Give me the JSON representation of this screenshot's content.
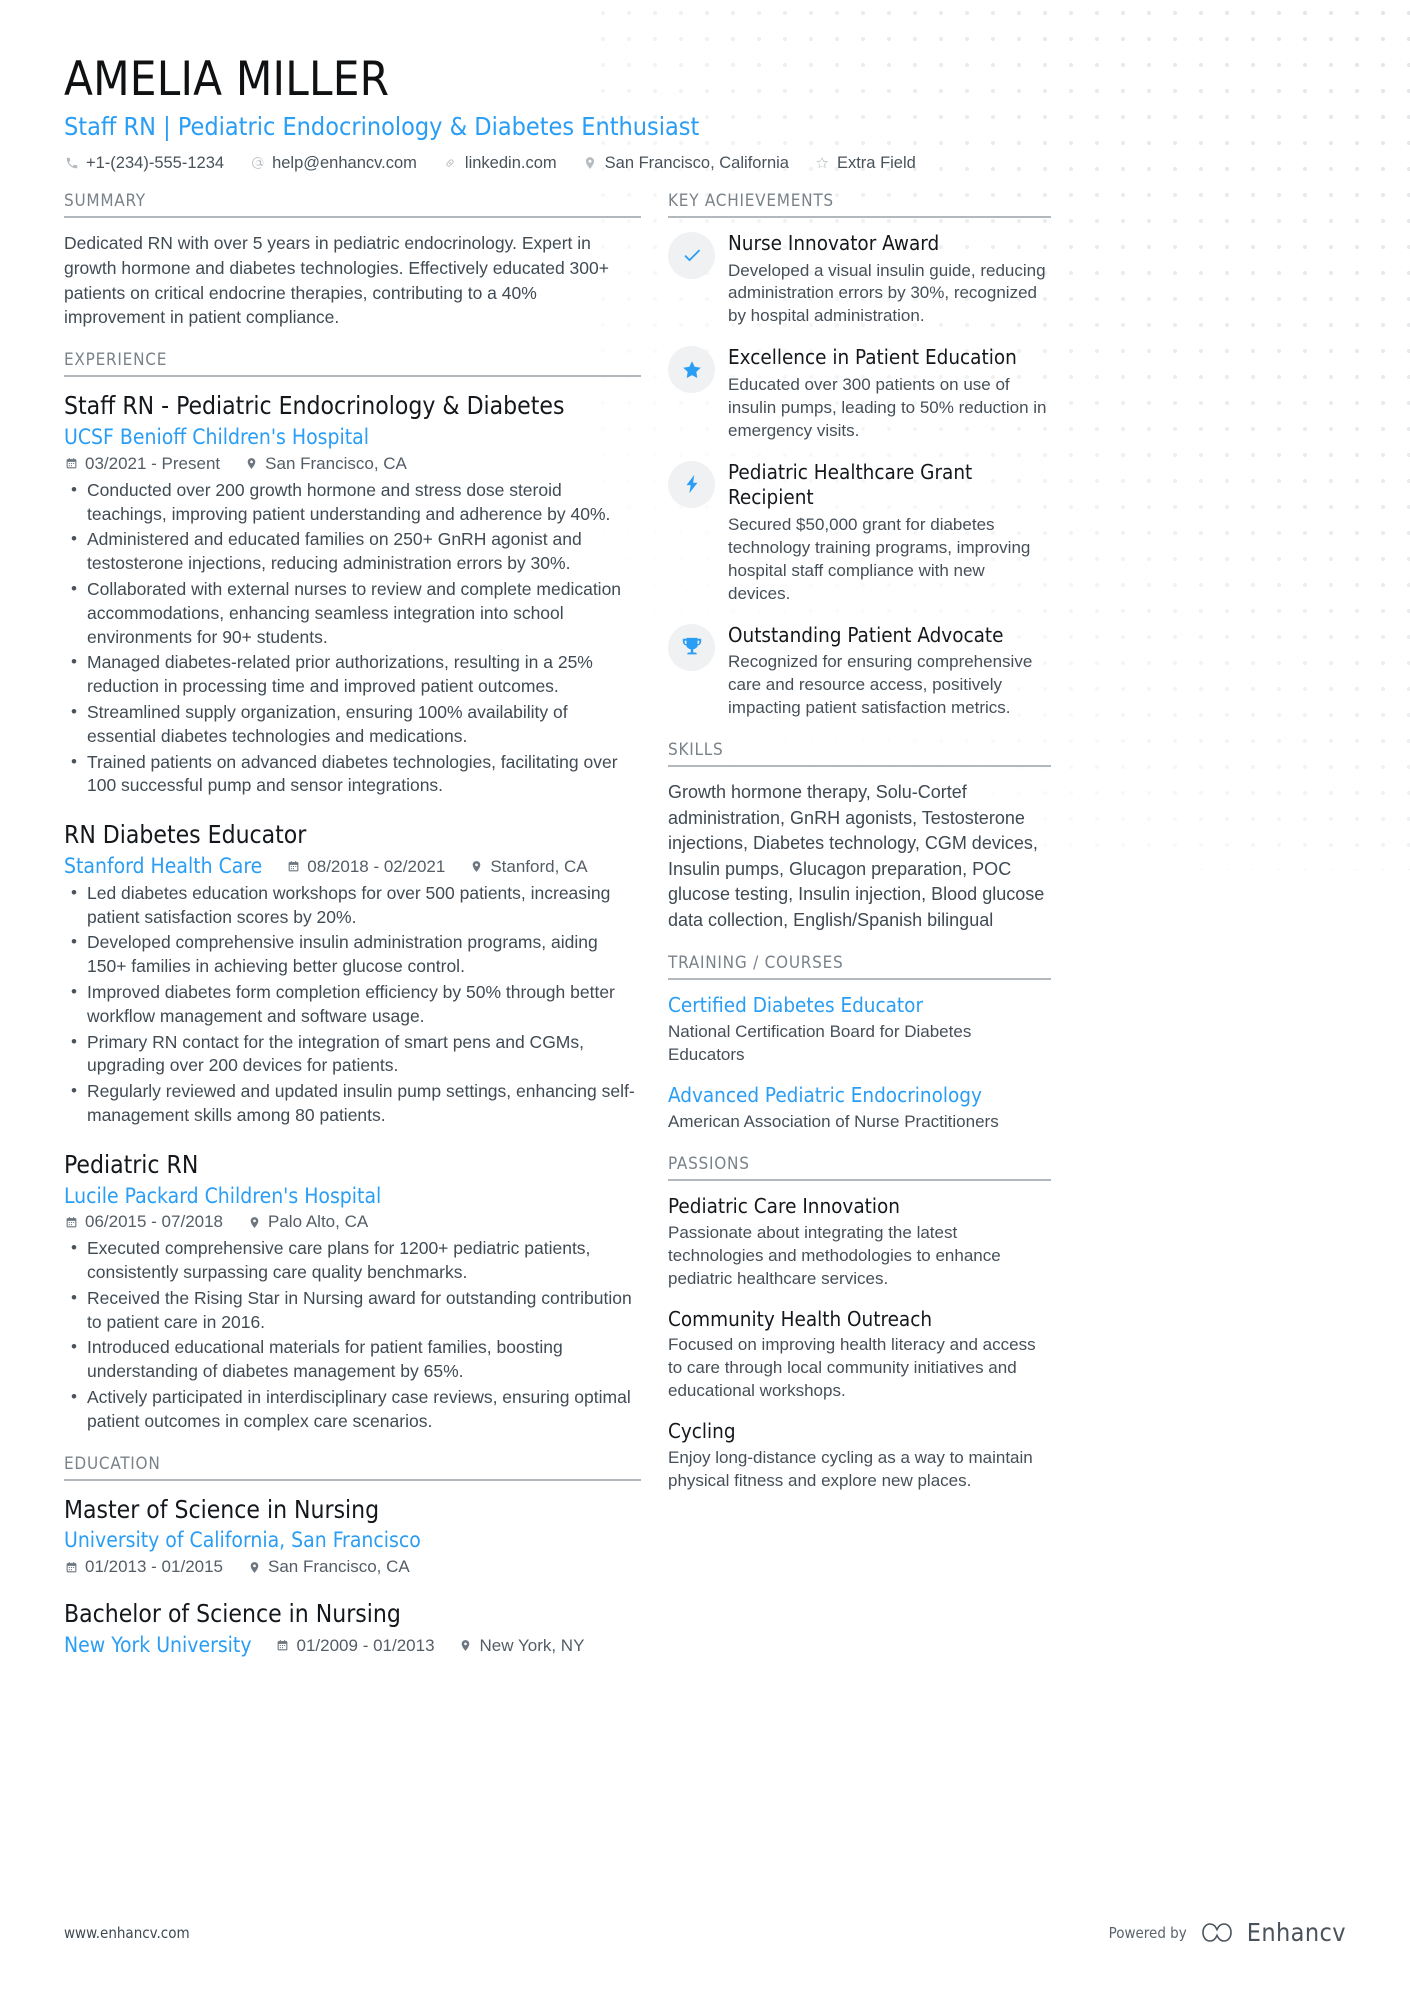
{
  "theme": {
    "accent": "#2a9df4",
    "text": "#3a4750",
    "muted": "#7a8289",
    "icon_bg": "#f0f1f2"
  },
  "header": {
    "name": "AMELIA MILLER",
    "headline": "Staff RN | Pediatric Endocrinology & Diabetes Enthusiast",
    "contacts": [
      {
        "icon": "phone-icon",
        "text": "+1-(234)-555-1234"
      },
      {
        "icon": "email-icon",
        "text": "help@enhancv.com"
      },
      {
        "icon": "link-icon",
        "text": "linkedin.com"
      },
      {
        "icon": "location-icon",
        "text": "San Francisco, California"
      },
      {
        "icon": "star-outline-icon",
        "text": "Extra Field"
      }
    ]
  },
  "left": {
    "summary": {
      "title": "SUMMARY",
      "text": "Dedicated RN with over 5 years in pediatric endocrinology. Expert in growth hormone and diabetes technologies. Effectively educated 300+ patients on critical endocrine therapies, contributing to a 40% improvement in patient compliance."
    },
    "experience": {
      "title": "EXPERIENCE",
      "jobs": [
        {
          "title": "Staff RN - Pediatric Endocrinology & Diabetes",
          "company": "UCSF Benioff Children's Hospital",
          "dates": "03/2021 - Present",
          "location": "San Francisco, CA",
          "inline_meta": false,
          "bullets": [
            "Conducted over 200 growth hormone and stress dose steroid teachings, improving patient understanding and adherence by 40%.",
            "Administered and educated families on 250+ GnRH agonist and testosterone injections, reducing administration errors by 30%.",
            "Collaborated with external nurses to review and complete medication accommodations, enhancing seamless integration into school environments for 90+ students.",
            "Managed diabetes-related prior authorizations, resulting in a 25% reduction in processing time and improved patient outcomes.",
            "Streamlined supply organization, ensuring 100% availability of essential diabetes technologies and medications.",
            "Trained patients on advanced diabetes technologies, facilitating over 100 successful pump and sensor integrations."
          ]
        },
        {
          "title": "RN Diabetes Educator",
          "company": "Stanford Health Care",
          "dates": "08/2018 - 02/2021",
          "location": "Stanford, CA",
          "inline_meta": true,
          "bullets": [
            "Led diabetes education workshops for over 500 patients, increasing patient satisfaction scores by 20%.",
            "Developed comprehensive insulin administration programs, aiding 150+ families in achieving better glucose control.",
            "Improved diabetes form completion efficiency by 50% through better workflow management and software usage.",
            "Primary RN contact for the integration of smart pens and CGMs, upgrading over 200 devices for patients.",
            "Regularly reviewed and updated insulin pump settings, enhancing self-management skills among 80 patients."
          ]
        },
        {
          "title": "Pediatric RN",
          "company": "Lucile Packard Children's Hospital",
          "dates": "06/2015 - 07/2018",
          "location": "Palo Alto, CA",
          "inline_meta": false,
          "bullets": [
            "Executed comprehensive care plans for 1200+ pediatric patients, consistently surpassing care quality benchmarks.",
            "Received the Rising Star in Nursing award for outstanding contribution to patient care in 2016.",
            "Introduced educational materials for patient families, boosting understanding of diabetes management by 65%.",
            "Actively participated in interdisciplinary case reviews, ensuring optimal patient outcomes in complex care scenarios."
          ]
        }
      ]
    },
    "education": {
      "title": "EDUCATION",
      "items": [
        {
          "title": "Master of Science in Nursing",
          "company": "University of California, San Francisco",
          "dates": "01/2013 - 01/2015",
          "location": "San Francisco, CA",
          "inline_meta": false
        },
        {
          "title": "Bachelor of Science in Nursing",
          "company": "New York University",
          "dates": "01/2009 - 01/2013",
          "location": "New York, NY",
          "inline_meta": true
        }
      ]
    }
  },
  "right": {
    "achievements": {
      "title": "KEY ACHIEVEMENTS",
      "items": [
        {
          "icon": "check-icon",
          "title": "Nurse Innovator Award",
          "desc": "Developed a visual insulin guide, reducing administration errors by 30%, recognized by hospital administration."
        },
        {
          "icon": "star-icon",
          "title": "Excellence in Patient Education",
          "desc": "Educated over 300 patients on use of insulin pumps, leading to 50% reduction in emergency visits."
        },
        {
          "icon": "bolt-icon",
          "title": "Pediatric Healthcare Grant Recipient",
          "desc": "Secured $50,000 grant for diabetes technology training programs, improving hospital staff compliance with new devices."
        },
        {
          "icon": "trophy-icon",
          "title": "Outstanding Patient Advocate",
          "desc": "Recognized for ensuring comprehensive care and resource access, positively impacting patient satisfaction metrics."
        }
      ]
    },
    "skills": {
      "title": "SKILLS",
      "text": "Growth hormone therapy, Solu-Cortef administration, GnRH agonists, Testosterone injections, Diabetes technology, CGM devices, Insulin pumps, Glucagon preparation, POC glucose testing, Insulin injection, Blood glucose data collection, English/Spanish bilingual"
    },
    "training": {
      "title": "TRAINING / COURSES",
      "items": [
        {
          "title": "Certified Diabetes Educator",
          "sub": "National Certification Board for Diabetes Educators"
        },
        {
          "title": "Advanced Pediatric Endocrinology",
          "sub": "American Association of Nurse Practitioners"
        }
      ]
    },
    "passions": {
      "title": "PASSIONS",
      "items": [
        {
          "title": "Pediatric Care Innovation",
          "sub": "Passionate about integrating the latest technologies and methodologies to enhance pediatric healthcare services."
        },
        {
          "title": "Community Health Outreach",
          "sub": "Focused on improving health literacy and access to care through local community initiatives and educational workshops."
        },
        {
          "title": "Cycling",
          "sub": "Enjoy long-distance cycling as a way to maintain physical fitness and explore new places."
        }
      ]
    }
  },
  "footer": {
    "url": "www.enhancv.com",
    "powered_by": "Powered by",
    "brand": "Enhancv"
  }
}
